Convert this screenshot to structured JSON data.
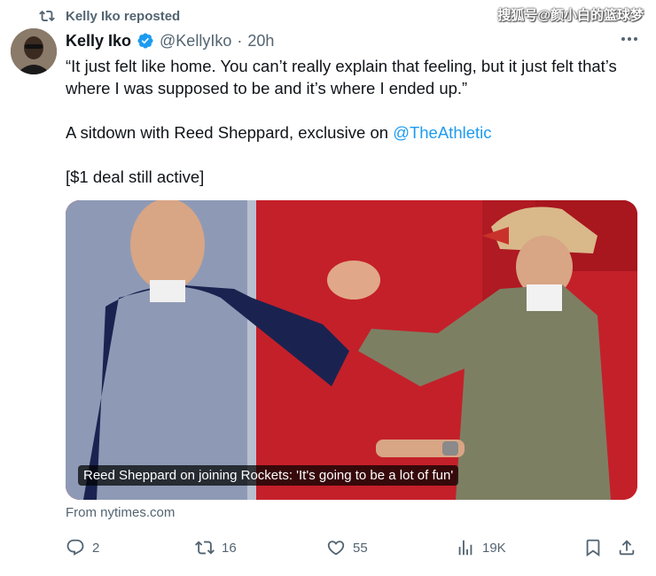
{
  "repost": {
    "label": "Kelly Iko reposted"
  },
  "watermark": {
    "text": "搜狐号@颜小白的篮球梦"
  },
  "author": {
    "name": "Kelly Iko",
    "handle": "@KellyIko",
    "separator": "·",
    "time": "20h"
  },
  "tweet": {
    "line1": "“It just felt like home. You can’t really explain that feeling, but it just felt that’s where I was supposed to be and it’s where I ended up.”",
    "line2_prefix": "A sitdown with Reed Sheppard, exclusive on ",
    "line2_mention": "@TheAthletic",
    "line3": "[$1 deal still active]"
  },
  "media": {
    "caption": "Reed Sheppard on joining Rockets: 'It's going to be a lot of fun'"
  },
  "source": {
    "text": "From nytimes.com"
  },
  "actions": {
    "replies": "2",
    "reposts": "16",
    "likes": "55",
    "views": "19K"
  },
  "icons": {
    "repost": "repost-icon",
    "verified": "verified-badge-icon",
    "more": "more-dots-icon",
    "reply": "reply-icon",
    "like": "heart-icon",
    "views": "views-chart-icon",
    "bookmark": "bookmark-icon",
    "share": "share-icon"
  },
  "colors": {
    "accent": "#1d9bf0",
    "muted": "#536471",
    "text": "#0f1419"
  }
}
